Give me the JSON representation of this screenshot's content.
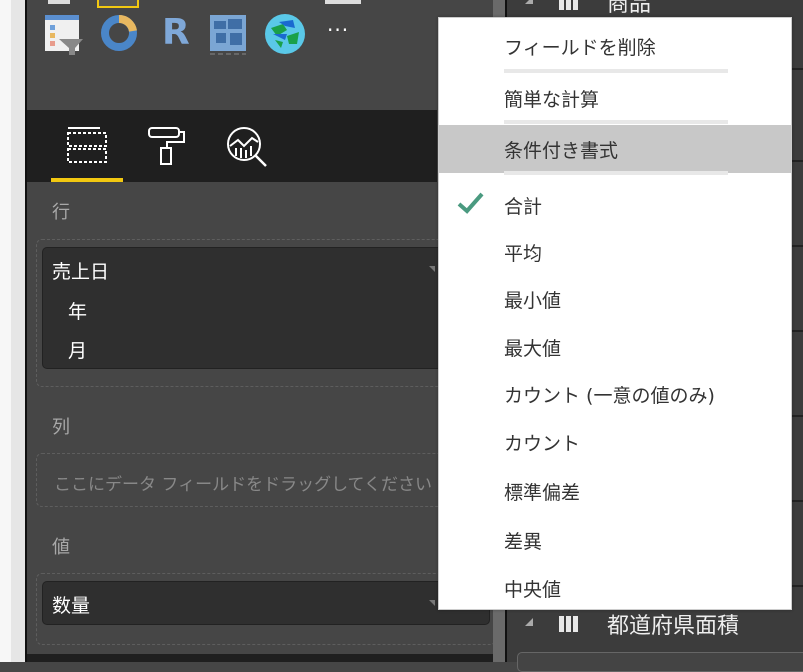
{
  "visualizations": {
    "icons": [
      "slicer-icon",
      "donut-chart-icon",
      "r-script-icon",
      "filled-map-icon",
      "globe-map-icon"
    ],
    "more_label": "···"
  },
  "pane_tabs": [
    {
      "icon": "fields-icon",
      "active": true
    },
    {
      "icon": "format-paint-roller-icon"
    },
    {
      "icon": "analytics-icon"
    }
  ],
  "accent_color": "#f2c811",
  "wells": {
    "rows": {
      "label": "行",
      "field": "売上日",
      "children": [
        "年",
        "月"
      ]
    },
    "columns": {
      "label": "列",
      "placeholder": "ここにデータ フィールドをドラッグしてください"
    },
    "values": {
      "label": "値",
      "field": "数量"
    }
  },
  "field_list": {
    "tables": [
      "商品",
      "都道府県面積"
    ]
  },
  "context_menu": {
    "items": [
      "フィールドを削除",
      "簡単な計算",
      "条件付き書式"
    ],
    "highlighted": "条件付き書式",
    "aggregations": [
      "合計",
      "平均",
      "最小値",
      "最大値",
      "カウント (一意の値のみ)",
      "カウント",
      "標準偏差",
      "差異",
      "中央値"
    ],
    "checked": "合計",
    "check_color": "#4a9a80"
  }
}
